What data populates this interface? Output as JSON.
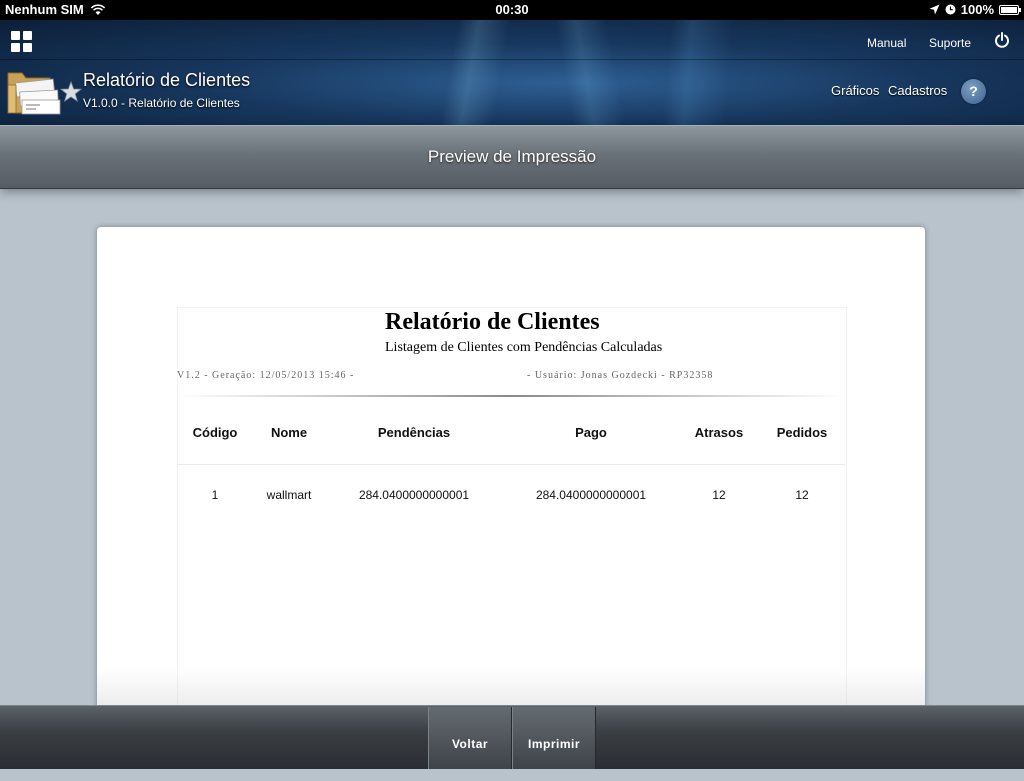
{
  "status_bar": {
    "carrier": "Nenhum SIM",
    "time": "00:30",
    "battery": "100%",
    "icons": [
      "wifi-icon",
      "location-arrow-icon",
      "clock-icon",
      "battery-icon"
    ]
  },
  "header": {
    "top_links": {
      "manual": "Manual",
      "support": "Suporte"
    },
    "app_title": "Relatório de Clientes",
    "app_version": "V1.0.0 - Relatório de Clientes",
    "nav": {
      "charts": "Gráficos",
      "registries": "Cadastros",
      "help": "?"
    },
    "icons": [
      "grid-menu-icon",
      "power-icon",
      "folder-icon",
      "star-icon"
    ]
  },
  "titlebar": {
    "title": "Preview de Impressão"
  },
  "report": {
    "title": "Relatório de Clientes",
    "subtitle": "Listagem de Clientes com Pendências Calculadas",
    "meta_left": "V1.2 - Geração: 12/05/2013 15:46 -",
    "meta_right": "- Usuário: Jonas Gozdecki - RP32358",
    "columns": [
      "Código",
      "Nome",
      "Pendências",
      "Pago",
      "Atrasos",
      "Pedidos"
    ],
    "rows": [
      [
        "1",
        "wallmart",
        "284.0400000000001",
        "284.0400000000001",
        "12",
        "12"
      ]
    ]
  },
  "toolbar": {
    "back": "Voltar",
    "print": "Imprimir"
  },
  "colors": {
    "header_dark": "#0c1f38",
    "header_mid": "#2e5f93",
    "titlebar": "#6a7279",
    "background": "#b9c3cc",
    "help_button": "#4f739f"
  }
}
